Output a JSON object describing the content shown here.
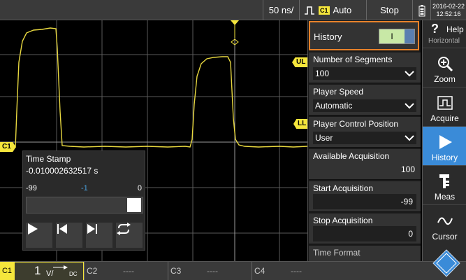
{
  "topbar": {
    "timebase": "50 ns/",
    "trigger_channel": "C1",
    "trigger_mode": "Auto",
    "run_state": "Stop",
    "date": "2016-02-22",
    "time": "12:52:16"
  },
  "plot": {
    "marker_c1": "C1",
    "marker_ul": "UL",
    "marker_ll": "LL"
  },
  "timestamp_panel": {
    "title": "Time Stamp",
    "value": "-0.010002632517 s",
    "scale_min": "-99",
    "scale_current": "-1",
    "scale_max": "0"
  },
  "settings": {
    "history": {
      "label": "History",
      "toggle_state": "I"
    },
    "number_of_segments": {
      "label": "Number of Segments",
      "value": "100"
    },
    "player_speed": {
      "label": "Player Speed",
      "value": "Automatic"
    },
    "player_control_position": {
      "label": "Player Control Position",
      "value": "User"
    },
    "available_acquisition": {
      "label": "Available Acquisition",
      "value": "100"
    },
    "start_acquisition": {
      "label": "Start Acquisition",
      "value": "-99"
    },
    "stop_acquisition": {
      "label": "Stop Acquisition",
      "value": "0"
    },
    "time_format": {
      "label": "Time Format"
    }
  },
  "rightbar": {
    "help_label": "Help",
    "help_sub": "Horizontal",
    "items": [
      {
        "label": "Zoom",
        "icon": "zoom-icon"
      },
      {
        "label": "Acquire",
        "icon": "acquire-icon"
      },
      {
        "label": "History",
        "icon": "play-icon",
        "active": true
      },
      {
        "label": "Meas",
        "icon": "meas-icon"
      },
      {
        "label": "Cursor",
        "icon": "cursor-icon"
      }
    ]
  },
  "bottombar": {
    "c1": {
      "tag": "C1",
      "scale": "1",
      "unit": "V/",
      "coupling": "DC"
    },
    "c2": {
      "tag": "C2",
      "value": "----"
    },
    "c3": {
      "tag": "C3",
      "value": "----"
    },
    "c4": {
      "tag": "C4",
      "value": "----"
    }
  },
  "colors": {
    "channel1": "#f5e63c",
    "accent_active": "#3a8bd8",
    "focus_border": "#e8822a",
    "toggle_on": "#c8e8a6"
  }
}
